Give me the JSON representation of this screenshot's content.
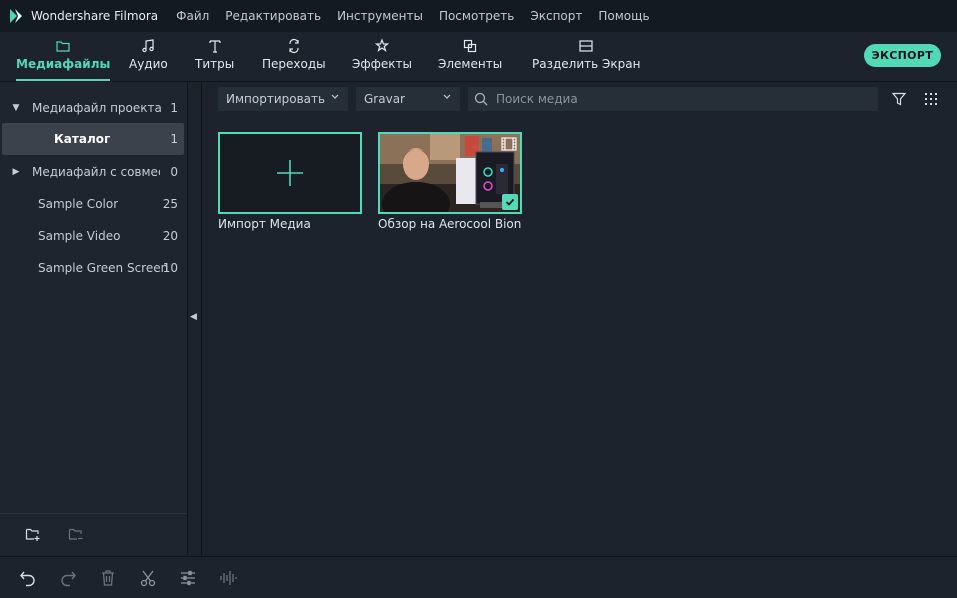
{
  "app": {
    "title": "Wondershare Filmora"
  },
  "menu": [
    "Файл",
    "Редактировать",
    "Инструменты",
    "Посмотреть",
    "Экспорт",
    "Помощь"
  ],
  "toolbar": {
    "tabs": [
      {
        "label": "Медиафайлы",
        "icon": "folder-icon",
        "active": true
      },
      {
        "label": "Аудио",
        "icon": "music-note-icon",
        "active": false
      },
      {
        "label": "Титры",
        "icon": "text-icon",
        "active": false
      },
      {
        "label": "Переходы",
        "icon": "transition-icon",
        "active": false
      },
      {
        "label": "Эффекты",
        "icon": "effects-icon",
        "active": false
      },
      {
        "label": "Элементы",
        "icon": "elements-icon",
        "active": false
      },
      {
        "label": "Разделить Экран",
        "icon": "split-screen-icon",
        "active": false
      }
    ],
    "export_label": "ЭКСПОРТ"
  },
  "sidebar": {
    "items": [
      {
        "label": "Медиафайл проекта",
        "count": "1",
        "caret": "down"
      },
      {
        "label": "Каталог",
        "count": "1",
        "selected": true
      },
      {
        "label": "Медиафайл с совместимостью",
        "count": "0",
        "caret": "right"
      },
      {
        "label": "Sample Color",
        "count": "25"
      },
      {
        "label": "Sample Video",
        "count": "20"
      },
      {
        "label": "Sample Green Screen",
        "count": "10"
      }
    ]
  },
  "filterbar": {
    "import_label": "Импортировать",
    "sort_label": "Gravar",
    "search_placeholder": "Поиск медиа"
  },
  "media": [
    {
      "label": "Импорт Медиа",
      "type": "import"
    },
    {
      "label": "Обзор на Aerocool Bioni...",
      "type": "video",
      "selected": true
    }
  ],
  "colors": {
    "accent": "#53d8b8",
    "background": "#1c232c",
    "titlebar": "#141a21"
  }
}
